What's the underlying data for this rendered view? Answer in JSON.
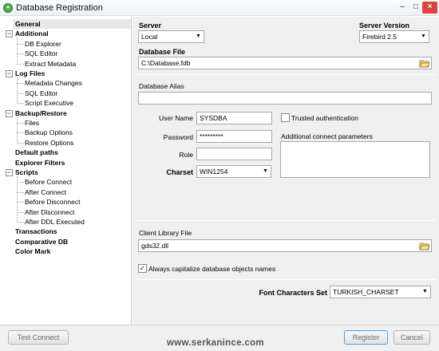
{
  "window": {
    "title": "Database Registration",
    "icon": "app-icon",
    "controls": {
      "minimize": "–",
      "maximize": "□",
      "close": "×"
    }
  },
  "tree": {
    "items": [
      {
        "label": "General",
        "level": 0,
        "bold": true,
        "selected": true
      },
      {
        "label": "Additional",
        "level": 0,
        "bold": true,
        "expander": "−"
      },
      {
        "label": "DB Explorer",
        "level": 1
      },
      {
        "label": "SQL Editor",
        "level": 1
      },
      {
        "label": "Extract Metadata",
        "level": 1
      },
      {
        "label": "Log Files",
        "level": 0,
        "bold": true,
        "expander": "−"
      },
      {
        "label": "Metadata Changes",
        "level": 1
      },
      {
        "label": "SQL Editor",
        "level": 1
      },
      {
        "label": "Script Executive",
        "level": 1
      },
      {
        "label": "Backup/Restore",
        "level": 0,
        "bold": true,
        "expander": "−"
      },
      {
        "label": "Files",
        "level": 1
      },
      {
        "label": "Backup Options",
        "level": 1
      },
      {
        "label": "Restore Options",
        "level": 1
      },
      {
        "label": "Default paths",
        "level": 0,
        "bold": true
      },
      {
        "label": "Explorer Filters",
        "level": 0,
        "bold": true
      },
      {
        "label": "Scripts",
        "level": 0,
        "bold": true,
        "expander": "−"
      },
      {
        "label": "Before Connect",
        "level": 1
      },
      {
        "label": "After Connect",
        "level": 1
      },
      {
        "label": "Before Disconnect",
        "level": 1
      },
      {
        "label": "After Disconnect",
        "level": 1
      },
      {
        "label": "After DDL Executed",
        "level": 1
      },
      {
        "label": "Transactions",
        "level": 0,
        "bold": true
      },
      {
        "label": "Comparative DB",
        "level": 0,
        "bold": true
      },
      {
        "label": "Color Mark",
        "level": 0,
        "bold": true
      }
    ]
  },
  "form": {
    "server_label": "Server",
    "server_value": "Local",
    "server_version_label": "Server Version",
    "server_version_value": "Firebird 2.5",
    "database_file_label": "Database File",
    "database_file_value": "C:\\Database.fdb",
    "database_alias_label": "Database Alias",
    "database_alias_value": "",
    "user_name_label": "User Name",
    "user_name_value": "SYSDBA",
    "password_label": "Password",
    "password_value": "*********",
    "role_label": "Role",
    "role_value": "",
    "charset_label": "Charset",
    "charset_value": "WIN1254",
    "trusted_auth_label": "Trusted authentication",
    "trusted_auth_checked": false,
    "additional_params_label": "Additional connect parameters",
    "client_library_label": "Client Library File",
    "client_library_value": "gds32.dll",
    "capitalize_label": "Always capitalize database objects names",
    "capitalize_checked": true,
    "check_mark": "✓",
    "font_charset_label": "Font Characters Set",
    "font_charset_value": "TURKISH_CHARSET",
    "dropdown_arrow": "▼"
  },
  "footer": {
    "test_connect_label": "Test Connect",
    "register_label": "Register",
    "cancel_label": "Cancel",
    "watermark": "www.serkanince.com"
  }
}
